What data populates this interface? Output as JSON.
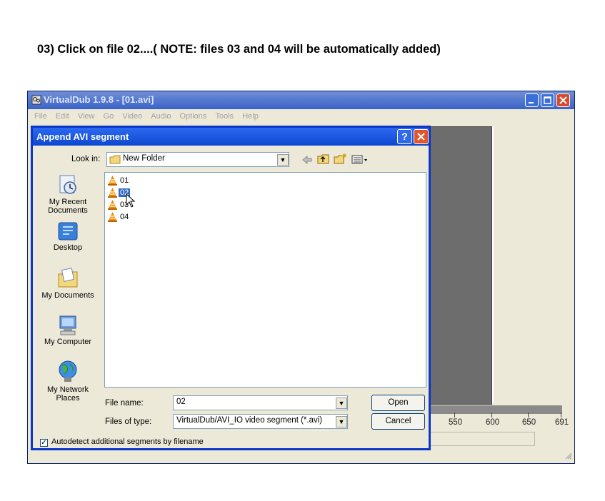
{
  "instruction": "03) Click on file 02....( NOTE: files 03 and 04 will be automatically added)",
  "main_window": {
    "title": "VirtualDub 1.9.8 - [01.avi]",
    "menu": [
      "File",
      "Edit",
      "View",
      "Go",
      "Video",
      "Audio",
      "Options",
      "Tools",
      "Help"
    ],
    "timeline_ticks": [
      "550",
      "600",
      "650",
      "691"
    ]
  },
  "dialog": {
    "title": "Append AVI segment",
    "help_label": "?",
    "look_in_label": "Look in:",
    "look_in_value": "New Folder",
    "places": [
      {
        "label": "My Recent Documents",
        "icon": "recent-documents-icon"
      },
      {
        "label": "Desktop",
        "icon": "desktop-icon"
      },
      {
        "label": "My Documents",
        "icon": "my-documents-icon"
      },
      {
        "label": "My Computer",
        "icon": "my-computer-icon"
      },
      {
        "label": "My Network Places",
        "icon": "network-places-icon"
      }
    ],
    "files": [
      {
        "name": "01",
        "selected": false
      },
      {
        "name": "02",
        "selected": true
      },
      {
        "name": "03",
        "selected": false
      },
      {
        "name": "04",
        "selected": false
      }
    ],
    "file_name_label": "File name:",
    "file_name_value": "02",
    "files_of_type_label": "Files of type:",
    "files_of_type_value": "VirtualDub/AVI_IO video segment (*.avi)",
    "open_label": "Open",
    "cancel_label": "Cancel",
    "autodetect_label": "Autodetect additional segments by filename",
    "autodetect_checked": "✓"
  }
}
